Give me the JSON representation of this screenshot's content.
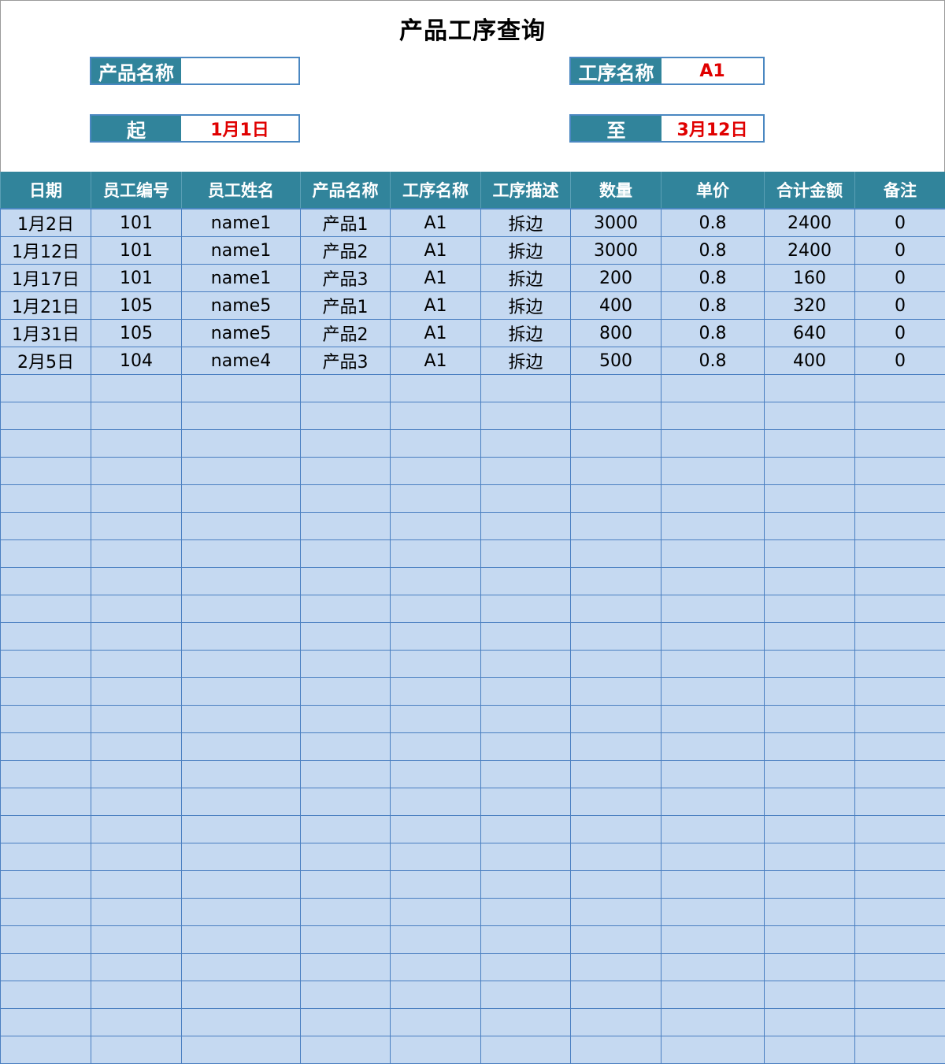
{
  "title": "产品工序查询",
  "filters": {
    "product_name_label": "产品名称",
    "product_name_value": "",
    "process_name_label": "工序名称",
    "process_name_value": "A1",
    "start_label": "起",
    "start_value": "1月1日",
    "end_label": "至",
    "end_value": "3月12日"
  },
  "table": {
    "headers": [
      "日期",
      "员工编号",
      "员工姓名",
      "产品名称",
      "工序名称",
      "工序描述",
      "数量",
      "单价",
      "合计金额",
      "备注"
    ],
    "rows": [
      [
        "1月2日",
        "101",
        "name1",
        "产品1",
        "A1",
        "拆边",
        "3000",
        "0.8",
        "2400",
        "0"
      ],
      [
        "1月12日",
        "101",
        "name1",
        "产品2",
        "A1",
        "拆边",
        "3000",
        "0.8",
        "2400",
        "0"
      ],
      [
        "1月17日",
        "101",
        "name1",
        "产品3",
        "A1",
        "拆边",
        "200",
        "0.8",
        "160",
        "0"
      ],
      [
        "1月21日",
        "105",
        "name5",
        "产品1",
        "A1",
        "拆边",
        "400",
        "0.8",
        "320",
        "0"
      ],
      [
        "1月31日",
        "105",
        "name5",
        "产品2",
        "A1",
        "拆边",
        "800",
        "0.8",
        "640",
        "0"
      ],
      [
        "2月5日",
        "104",
        "name4",
        "产品3",
        "A1",
        "拆边",
        "500",
        "0.8",
        "400",
        "0"
      ]
    ]
  },
  "colors": {
    "header_bg": "#31849b",
    "cell_bg": "#c5d9f1",
    "grid_line": "#4a7fc1",
    "value_red": "#e00000"
  }
}
